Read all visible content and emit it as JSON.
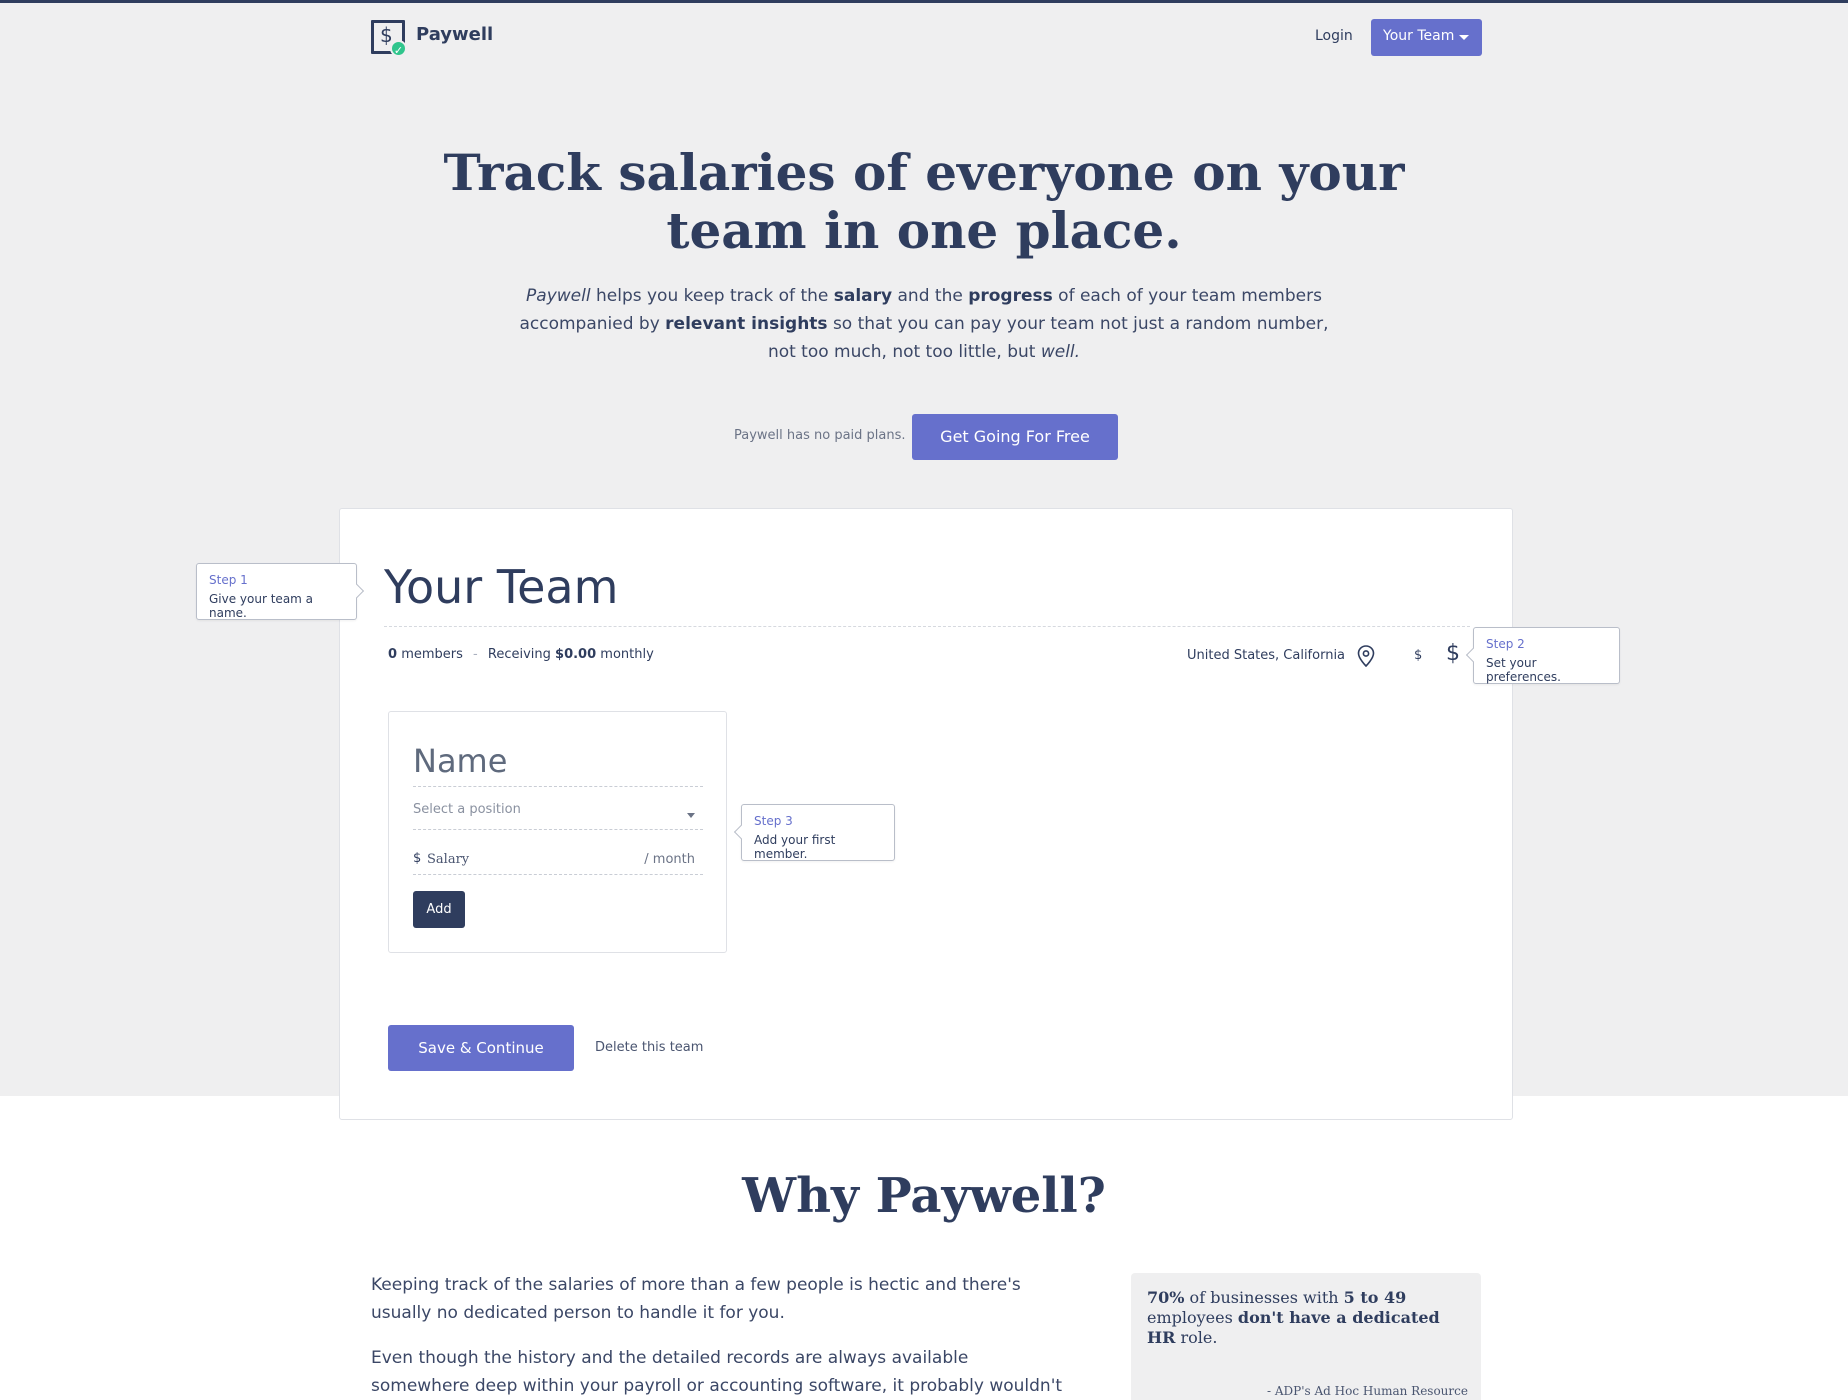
{
  "nav": {
    "brand": "Paywell",
    "login": "Login",
    "team_menu": "Your Team"
  },
  "hero": {
    "title": "Track salaries of everyone on your team in one place.",
    "sub_parts": {
      "p1": "Paywell",
      "p2": " helps you keep track of the ",
      "p3": "salary",
      "p4": " and the ",
      "p5": "progress",
      "p6": " of each of your team members accompanied by ",
      "p7": "relevant insights",
      "p8": " so that you can pay your team not just a random number, not too much, not too little, but ",
      "p9": "well."
    },
    "no_plans": "Paywell has no paid plans.",
    "cta": "Get Going For Free"
  },
  "team": {
    "title": "Your Team",
    "members_count": "0",
    "members_label": "members",
    "separator": "-",
    "receiving_label": "Receiving",
    "amount": "$0.00",
    "period": "monthly",
    "location": "United States, California",
    "currency_small": "$",
    "currency_big": "$"
  },
  "tips": {
    "step1": {
      "step": "Step 1",
      "text": "Give your team a name."
    },
    "step2": {
      "step": "Step 2",
      "text": "Set your preferences."
    },
    "step3": {
      "step": "Step 3",
      "text": "Add your first member."
    }
  },
  "member_form": {
    "name_placeholder": "Name",
    "position_placeholder": "Select a position",
    "salary_currency": "$",
    "salary_placeholder": "Salary",
    "salary_period": "/ month",
    "add": "Add"
  },
  "actions": {
    "save": "Save & Continue",
    "delete": "Delete this team"
  },
  "why": {
    "title": "Why Paywell?",
    "p1": "Keeping track of the salaries of more than a few people is hectic and there's usually no dedicated person to handle it for you.",
    "p2": "Even though the history and the detailed records are always available somewhere deep within your payroll or accounting software, it probably wouldn't be an easy process to",
    "quote": {
      "q1": "70%",
      "q2": " of businesses with ",
      "q3": "5 to 49",
      "q4": " employees ",
      "q5": "don't have a dedicated HR",
      "q6": " role.",
      "source": "- ADP's Ad Hoc Human Resource"
    }
  },
  "colors": {
    "primary": "#6670cc",
    "dark": "#2f3d5e",
    "hero_bg": "#efeff0",
    "check": "#2fc58c"
  },
  "icons": [
    "dollar-logo-icon",
    "check-icon",
    "caret-down-icon",
    "map-pin-icon",
    "dollar-icon",
    "select-arrow-icon"
  ]
}
